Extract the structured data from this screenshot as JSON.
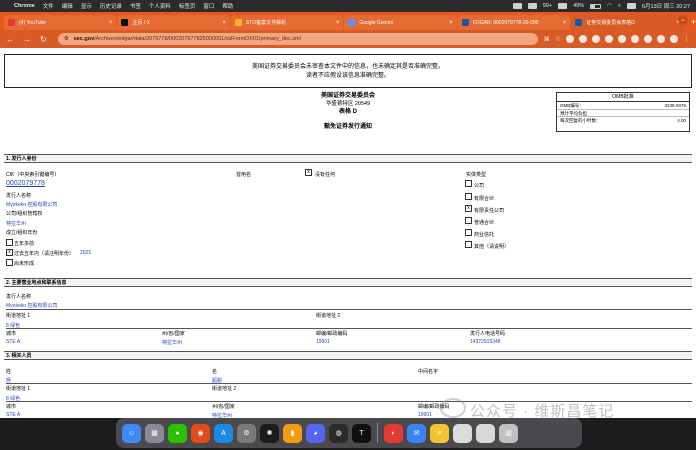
{
  "menubar": {
    "app": "Chrome",
    "items": [
      "文件",
      "编辑",
      "显示",
      "历史记录",
      "书签",
      "个人资料",
      "标签页",
      "窗口",
      "帮助"
    ],
    "right_items": [
      "99+",
      "49%",
      "6月13日 周三 20:27"
    ]
  },
  "tabs": [
    {
      "label": "(4) YouTube",
      "fav": "#e53935",
      "active": false
    },
    {
      "label": "主页 / X",
      "fav": "#111111",
      "active": false
    },
    {
      "label": "STO备案文件解析",
      "fav": "#f2b233",
      "active": false
    },
    {
      "label": "Google Gemini",
      "fav": "#6b8cff",
      "active": false
    },
    {
      "label": "EDGAR: 0002079778-26-000",
      "fav": "#1a56a8",
      "active": false
    },
    {
      "label": "证券交易委员会表格D",
      "fav": "#1a56a8",
      "active": true
    }
  ],
  "address": {
    "host": "sec.gov",
    "path": "/Archives/edgar/data/2079778/000207977825000001/xslFormDX01/primary_doc.xml"
  },
  "notice": {
    "line1": "美国证券交易委员会未审查本文件中的信息，也未确定其是否准确完整。",
    "line2": "读者不应假设该信息准确完整。"
  },
  "header": {
    "agency": "美国证券交易委员会",
    "city": "华盛顿特区 20549",
    "form": "表格 D",
    "title": "豁免证券发行通知"
  },
  "omb": {
    "title": "OMB批准",
    "rows": [
      {
        "k": "OMB编号：",
        "v": "3235-0076"
      },
      {
        "k": "预计平均负担",
        "v": ""
      },
      {
        "k": "每次回复的小时数：",
        "v": "4.00"
      }
    ]
  },
  "s1": {
    "heading": "1. 发行人身份",
    "cik_label": "CIK（中央索引键编号）",
    "cik": "0002079778",
    "prev_names_label": "曾用名",
    "prev_none": "没有任何",
    "entity_type_label": "实体类型",
    "issuer_name_label": "发行人名称",
    "issuer_name": "Myokeko 控股有限公司",
    "jurisdiction_label": "公司/组织管辖权",
    "jurisdiction": "特拉华州",
    "year_label": "成立/组织年份",
    "year_opts": [
      "五年多前",
      "过去五年内（请注明年份）",
      "尚未形成"
    ],
    "year_value": "2025",
    "entity_types": [
      "公司",
      "有限合伙",
      "有限责任公司",
      "普通合伙",
      "商业信托",
      "其他（请说明）"
    ]
  },
  "s2": {
    "heading": "2. 主要营业地点和联系信息",
    "issuer_name_label": "发行人名称",
    "issuer_name": "Myokeko 控股有限公司",
    "street1_label": "街道地址 1",
    "street1": "8 绿色",
    "street2_label": "街道地址 2",
    "city_label": "城市",
    "city": "STE A",
    "state_label": "州/省/国家",
    "state": "特拉华州",
    "zip_label": "邮编/邮政编码",
    "zip": "19901",
    "phone_label": "发行人电话号码",
    "phone": "14372915348"
  },
  "s3": {
    "heading": "3. 相关人员",
    "last_label": "姓",
    "last": "杨",
    "first_label": "名",
    "first": "超超",
    "middle_label": "中间名字",
    "street1_label": "街道地址 1",
    "street1": "8 绿色",
    "street2_label": "街道地址 2",
    "city_label": "城市",
    "city": "STE A",
    "state_label": "州/省/国家",
    "state": "特拉华州",
    "zip_label": "邮编/邮政编码",
    "zip": "19901"
  },
  "watermark": "公众号 · 维斯昌笔记",
  "dock": [
    {
      "name": "finder",
      "c": "#3d8af7"
    },
    {
      "name": "launchpad",
      "c": "#8a8a96"
    },
    {
      "name": "wechat",
      "c": "#2dc100"
    },
    {
      "name": "chrome",
      "c": "#e64a19"
    },
    {
      "name": "app-store",
      "c": "#1e88e5"
    },
    {
      "name": "system-settings",
      "c": "#7a7a7a"
    },
    {
      "name": "chatgpt",
      "c": "#1b1b1b"
    },
    {
      "name": "books",
      "c": "#f39c12"
    },
    {
      "name": "discord",
      "c": "#5865f2"
    },
    {
      "name": "photo-tool",
      "c": "#2b2b2b"
    },
    {
      "name": "tradingview",
      "c": "#111111"
    },
    {
      "name": "xiaohongshu",
      "c": "#e53935"
    },
    {
      "name": "mail",
      "c": "#3a83f1"
    },
    {
      "name": "notes",
      "c": "#f4c430"
    },
    {
      "name": "preview",
      "c": "#dcdcdc"
    },
    {
      "name": "downloads",
      "c": "#d8d8d8"
    },
    {
      "name": "trash",
      "c": "#c0c0c0"
    }
  ]
}
